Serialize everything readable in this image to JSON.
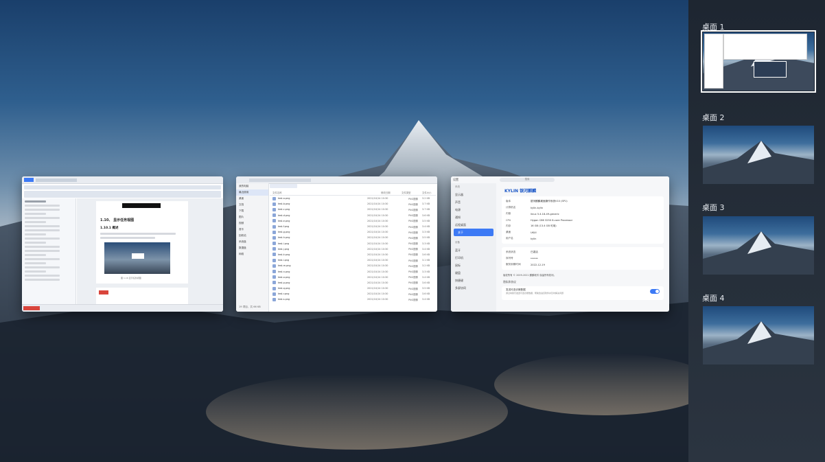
{
  "workspaces": {
    "items": [
      {
        "label": "桌面 1",
        "active": true
      },
      {
        "label": "桌面 2",
        "active": false
      },
      {
        "label": "桌面 3",
        "active": false
      },
      {
        "label": "桌面 4",
        "active": false
      }
    ]
  },
  "windows": {
    "document": {
      "heading_main": "1.10、 显示任务视图",
      "heading_sub": "1.10.1 概述",
      "footer_text": "图 1-16 显示任务视图"
    },
    "file_manager": {
      "sidebar": [
        "我的电脑",
        "最近使用",
        "桌面",
        "文档",
        "下载",
        "图片",
        "视频",
        "音乐",
        "回收站",
        "系统盘",
        "数据盘",
        "网络"
      ],
      "columns": [
        "文件名称",
        "修改日期",
        "文件类型",
        "文件大小"
      ],
      "files": [
        {
          "name": "test-a.png",
          "date": "2021/10/14 10:30",
          "type": "PNG图像",
          "size": "3.2 KB"
        },
        {
          "name": "test-b.png",
          "date": "2021/10/14 10:30",
          "type": "PNG图像",
          "size": "3.7 KB"
        },
        {
          "name": "test-c.png",
          "date": "2021/10/14 10:30",
          "type": "PNG图像",
          "size": "3.7 KB"
        },
        {
          "name": "test-d.png",
          "date": "2021/10/14 10:30",
          "type": "PNG图像",
          "size": "3.6 KB"
        },
        {
          "name": "test-e.png",
          "date": "2021/10/14 10:30",
          "type": "PNG图像",
          "size": "3.5 KB"
        },
        {
          "name": "test-f.png",
          "date": "2021/10/14 10:30",
          "type": "PNG图像",
          "size": "3.4 KB"
        },
        {
          "name": "test-g.png",
          "date": "2021/10/14 10:30",
          "type": "PNG图像",
          "size": "3.3 KB"
        },
        {
          "name": "test-h.png",
          "date": "2021/10/14 10:30",
          "type": "PNG图像",
          "size": "3.5 KB"
        },
        {
          "name": "test-i.png",
          "date": "2021/10/14 10:30",
          "type": "PNG图像",
          "size": "3.3 KB"
        },
        {
          "name": "test-j.png",
          "date": "2021/10/14 10:30",
          "type": "PNG图像",
          "size": "3.4 KB"
        },
        {
          "name": "test-k.png",
          "date": "2021/10/14 10:30",
          "type": "PNG图像",
          "size": "3.6 KB"
        },
        {
          "name": "test-l.png",
          "date": "2021/10/14 10:30",
          "type": "PNG图像",
          "size": "3.1 KB"
        },
        {
          "name": "test-m.png",
          "date": "2021/10/14 10:30",
          "type": "PNG图像",
          "size": "3.2 KB"
        },
        {
          "name": "test-n.png",
          "date": "2021/10/14 10:30",
          "type": "PNG图像",
          "size": "3.3 KB"
        },
        {
          "name": "test-o.png",
          "date": "2021/10/14 10:30",
          "type": "PNG图像",
          "size": "3.4 KB"
        },
        {
          "name": "test-p.png",
          "date": "2021/10/14 10:30",
          "type": "PNG图像",
          "size": "3.6 KB"
        },
        {
          "name": "test-q.png",
          "date": "2021/10/14 10:30",
          "type": "PNG图像",
          "size": "3.5 KB"
        },
        {
          "name": "test-r.png",
          "date": "2021/10/14 10:30",
          "type": "PNG图像",
          "size": "3.6 KB"
        },
        {
          "name": "test-s.png",
          "date": "2021/10/14 10:30",
          "type": "PNG图像",
          "size": "3.4 KB"
        }
      ],
      "bottom_bar": "19 项目，共 66 KB"
    },
    "settings": {
      "title": "设置",
      "search_placeholder": "搜索",
      "sidebar": [
        "系统",
        "显示器",
        "声音",
        "电源",
        "通知",
        "远程桌面",
        "关于",
        "设备",
        "蓝牙",
        "打印机",
        "鼠标",
        "键盘",
        "快捷键",
        "多屏协同"
      ],
      "brand": "KYLIN 银河麒麟",
      "info": [
        {
          "k": "版本",
          "v": "银河麒麟桌面操作系统V10 (SP1)"
        },
        {
          "k": "计算机名",
          "v": "kylin-kylin"
        },
        {
          "k": "内核",
          "v": "linux 5.4.18-49-generic"
        },
        {
          "k": "CPU",
          "v": "Hygon C86 3250 8-core Processor"
        },
        {
          "k": "内存",
          "v": "16 GB (13.4 GB 可用)"
        },
        {
          "k": "桌面",
          "v": "UKUI"
        },
        {
          "k": "用户名",
          "v": "kylin"
        }
      ],
      "activation": [
        {
          "k": "系统状态",
          "v": "已激活"
        },
        {
          "k": "序列号",
          "v": "******"
        },
        {
          "k": "服务到期时间",
          "v": "2022-12-19"
        }
      ],
      "copyright": "版权所有 © 2009-2021 麒麟软件 保留所有权利。",
      "privacy_title": "隐私和协议",
      "privacy_text": "发送可选诊断数据",
      "privacy_desc": "通过向我们发送可选诊断数据，帮助改进该软件并及时解决问题"
    }
  }
}
